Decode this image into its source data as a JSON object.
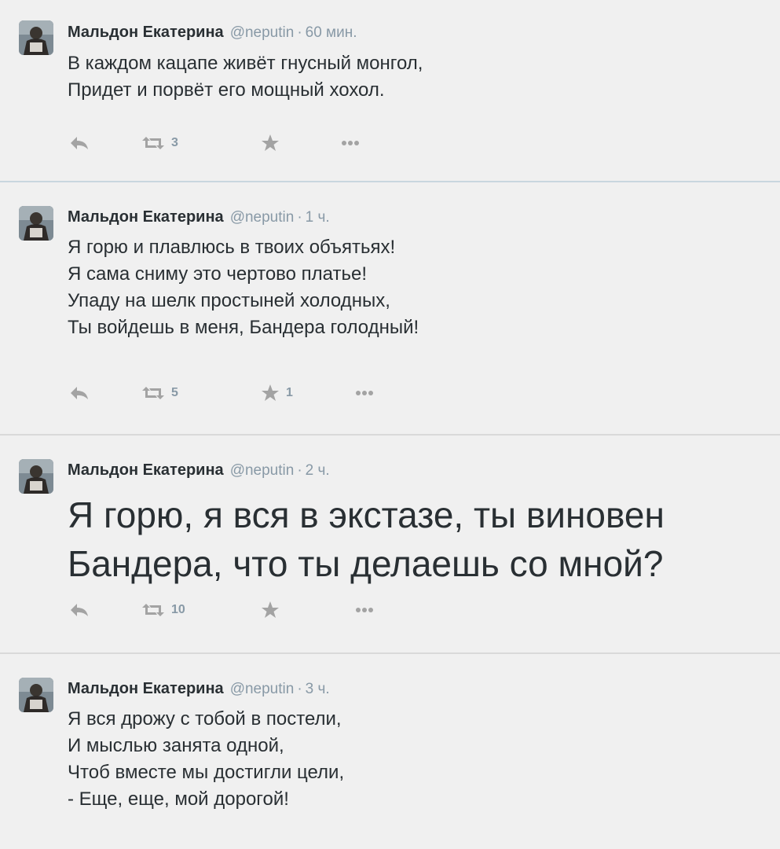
{
  "tweets": [
    {
      "author": "Мальдон Екатерина",
      "handle": "@neputin",
      "separator": "·",
      "time": "60 мин.",
      "lines": [
        "В каждом кацапе живёт гнусный монгол,",
        "Придет и порвёт его мощный хохол."
      ],
      "retweets": "3",
      "favorites": ""
    },
    {
      "author": "Мальдон Екатерина",
      "handle": "@neputin",
      "separator": "·",
      "time": "1 ч.",
      "lines": [
        "Я горю и плавлюсь в твоих объятьях!",
        "Я сама сниму это чертово платье!",
        "Упаду на шелк простыней холодных,",
        "Ты войдешь в меня, Бандера голодный!"
      ],
      "retweets": "5",
      "favorites": "1"
    },
    {
      "author": "Мальдон Екатерина",
      "handle": "@neputin",
      "separator": "·",
      "time": "2 ч.",
      "lines": [
        "Я горю, я вся в экстазе, ты виновен",
        "Бандера, что ты делаешь со мной?"
      ],
      "retweets": "10",
      "favorites": ""
    },
    {
      "author": "Мальдон Екатерина",
      "handle": "@neputin",
      "separator": "·",
      "time": "3 ч.",
      "lines": [
        "Я вся дрожу с тобой в постели,",
        "И мыслью занята одной,",
        "Чтоб вместе мы достигли цели,",
        "- Еще, еще, мой дорогой!"
      ]
    }
  ],
  "icons": {
    "reply": "reply-icon",
    "retweet": "retweet-icon",
    "favorite": "star-icon",
    "more": "more-dots-icon"
  },
  "colors": {
    "background": "#f0f0f0",
    "text": "#292f33",
    "meta": "#8899a6",
    "icon": "#999999",
    "divider_first": "#c9d6df",
    "divider": "#d9d9d9"
  }
}
